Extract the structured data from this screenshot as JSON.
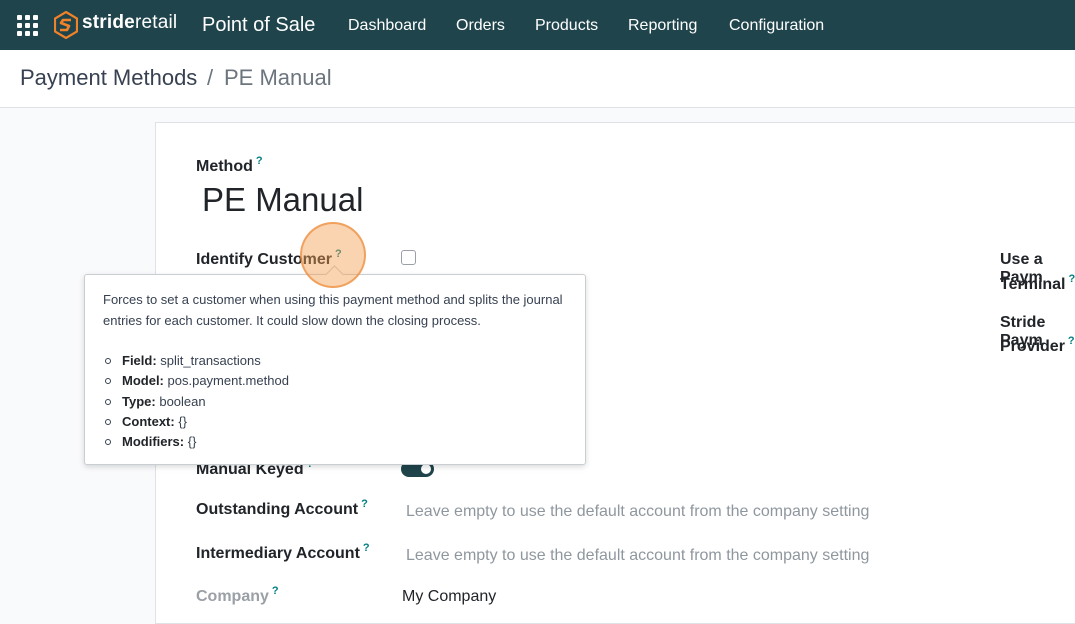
{
  "nav": {
    "brand_bold": "stride",
    "brand_rest": "retail",
    "app_title": "Point of Sale",
    "items": [
      "Dashboard",
      "Orders",
      "Products",
      "Reporting",
      "Configuration"
    ]
  },
  "breadcrumb": {
    "parent": "Payment Methods",
    "separator": "/",
    "current": "PE Manual"
  },
  "form": {
    "help_mark": "?",
    "method_label": "Method",
    "method_name": "PE Manual",
    "identify_customer_label": "Identify Customer",
    "identify_customer_checked": false,
    "manual_keyed_label": "Manual Keyed",
    "manual_keyed_on": true,
    "outstanding_account_label": "Outstanding Account",
    "outstanding_account_placeholder": "Leave empty to use the default account from the company setting",
    "intermediary_account_label": "Intermediary Account",
    "intermediary_account_placeholder": "Leave empty to use the default account from the company setting",
    "company_label": "Company",
    "company_value": "My Company",
    "payment_terminal_label_1": "Use a Paym",
    "payment_terminal_label_2": "Terminal",
    "payment_provider_label_1": "Stride Paym",
    "payment_provider_label_2": "Provider"
  },
  "tooltip": {
    "description": "Forces to set a customer when using this payment method and splits the journal entries for each customer. It could slow down the closing process.",
    "field_key": "Field:",
    "field_value": "split_transactions",
    "model_key": "Model:",
    "model_value": "pos.payment.method",
    "type_key": "Type:",
    "type_value": "boolean",
    "context_key": "Context:",
    "context_value": "{}",
    "modifiers_key": "Modifiers:",
    "modifiers_value": "{}"
  },
  "colors": {
    "navbar": "#1f444b",
    "accent": "#017e84",
    "logo_orange": "#f0822a",
    "highlight": "#f59e50"
  }
}
